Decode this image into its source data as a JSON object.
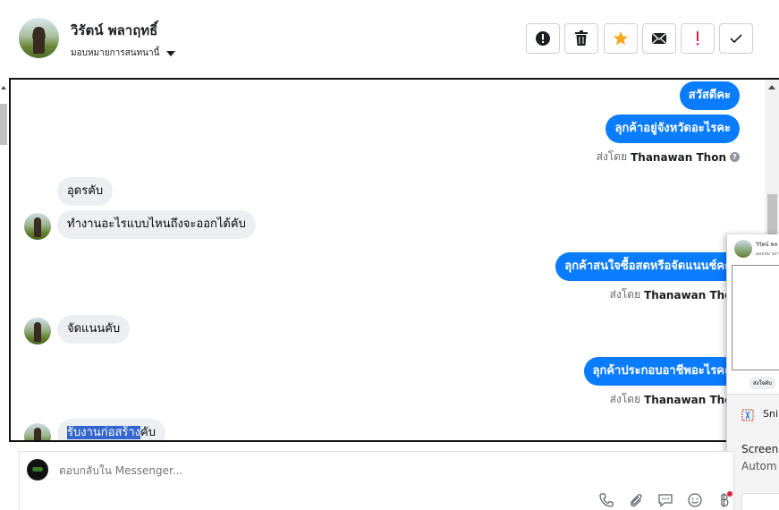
{
  "header": {
    "contact_name": "วิรัตน์ พลาฤทธิ์",
    "assign_label": "มอบหมายการสนทนานี้",
    "toolbar": [
      {
        "name": "spam-button",
        "icon": "alert-circle-icon"
      },
      {
        "name": "delete-button",
        "icon": "trash-icon"
      },
      {
        "name": "star-button",
        "icon": "star-icon"
      },
      {
        "name": "mark-unread-button",
        "icon": "envelope-icon"
      },
      {
        "name": "mark-important-button",
        "icon": "exclamation-icon"
      },
      {
        "name": "mark-done-button",
        "icon": "check-icon"
      }
    ]
  },
  "messages": {
    "out1": "สวัสดีคะ",
    "out2": "ลุกค้าอยู่จังหวัดอะไรคะ",
    "sent_by_prefix": "ส่งโดย",
    "sent_by_name": "Thanawan Thon",
    "in1": "อุดรคับ",
    "in2": "ทำงานอะไรแบบไหนถึงจะออกได้คับ",
    "out3": "ลุกค้าสนใจซื้อสดหรือจัดแนนช์คะ",
    "in3": "จัดแนนคับ",
    "out4": "ลุกค้าประกอบอาชีพอะไรคะ",
    "in4_highlight": "รับงานก่อสร้าง",
    "in4_rest": "คับ"
  },
  "popup": {
    "mini_name": "วิรัตน์ พล",
    "mini_sub": "มอบหมายการ",
    "mini_bubble": "ส่งใจคับ",
    "snip_title": "Snip",
    "snip_line1": "Screen",
    "snip_line2": "Autom"
  },
  "composer": {
    "placeholder": "ตอบกลับใน Messenger..."
  },
  "colors": {
    "bubble_out": "#0a7cff",
    "bubble_in": "#eceef1",
    "star": "#f5a623",
    "important": "#e41e3f",
    "selection": "#3366cc"
  }
}
